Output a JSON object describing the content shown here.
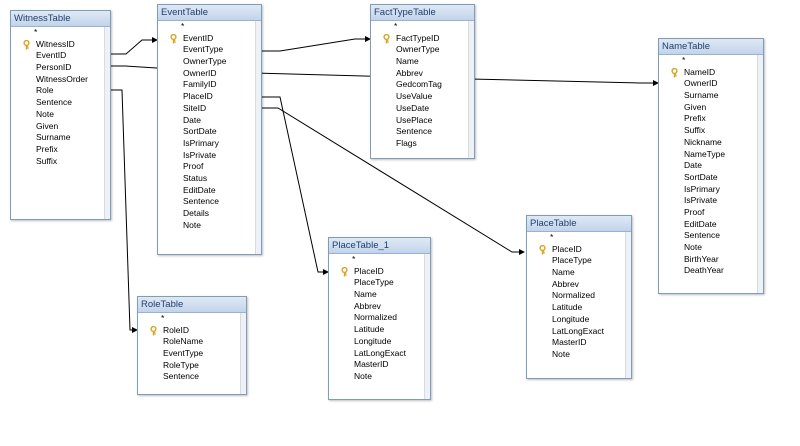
{
  "tables": {
    "witness": {
      "title": "WitnessTable",
      "fields": [
        {
          "name": "*",
          "key": false
        },
        {
          "name": "WitnessID",
          "key": true
        },
        {
          "name": "EventID",
          "key": false
        },
        {
          "name": "PersonID",
          "key": false
        },
        {
          "name": "WitnessOrder",
          "key": false
        },
        {
          "name": "Role",
          "key": false
        },
        {
          "name": "Sentence",
          "key": false
        },
        {
          "name": "Note",
          "key": false
        },
        {
          "name": "Given",
          "key": false
        },
        {
          "name": "Surname",
          "key": false
        },
        {
          "name": "Prefix",
          "key": false
        },
        {
          "name": "Suffix",
          "key": false
        }
      ]
    },
    "event": {
      "title": "EventTable",
      "fields": [
        {
          "name": "*",
          "key": false
        },
        {
          "name": "EventID",
          "key": true
        },
        {
          "name": "EventType",
          "key": false
        },
        {
          "name": "OwnerType",
          "key": false
        },
        {
          "name": "OwnerID",
          "key": false
        },
        {
          "name": "FamilyID",
          "key": false
        },
        {
          "name": "PlaceID",
          "key": false
        },
        {
          "name": "SiteID",
          "key": false
        },
        {
          "name": "Date",
          "key": false
        },
        {
          "name": "SortDate",
          "key": false
        },
        {
          "name": "IsPrimary",
          "key": false
        },
        {
          "name": "IsPrivate",
          "key": false
        },
        {
          "name": "Proof",
          "key": false
        },
        {
          "name": "Status",
          "key": false
        },
        {
          "name": "EditDate",
          "key": false
        },
        {
          "name": "Sentence",
          "key": false
        },
        {
          "name": "Details",
          "key": false
        },
        {
          "name": "Note",
          "key": false
        }
      ]
    },
    "facttype": {
      "title": "FactTypeTable",
      "fields": [
        {
          "name": "*",
          "key": false
        },
        {
          "name": "FactTypeID",
          "key": true
        },
        {
          "name": "OwnerType",
          "key": false
        },
        {
          "name": "Name",
          "key": false
        },
        {
          "name": "Abbrev",
          "key": false
        },
        {
          "name": "GedcomTag",
          "key": false
        },
        {
          "name": "UseValue",
          "key": false
        },
        {
          "name": "UseDate",
          "key": false
        },
        {
          "name": "UsePlace",
          "key": false
        },
        {
          "name": "Sentence",
          "key": false
        },
        {
          "name": "Flags",
          "key": false
        }
      ]
    },
    "name": {
      "title": "NameTable",
      "fields": [
        {
          "name": "*",
          "key": false
        },
        {
          "name": "NameID",
          "key": true
        },
        {
          "name": "OwnerID",
          "key": false
        },
        {
          "name": "Surname",
          "key": false
        },
        {
          "name": "Given",
          "key": false
        },
        {
          "name": "Prefix",
          "key": false
        },
        {
          "name": "Suffix",
          "key": false
        },
        {
          "name": "Nickname",
          "key": false
        },
        {
          "name": "NameType",
          "key": false
        },
        {
          "name": "Date",
          "key": false
        },
        {
          "name": "SortDate",
          "key": false
        },
        {
          "name": "IsPrimary",
          "key": false
        },
        {
          "name": "IsPrivate",
          "key": false
        },
        {
          "name": "Proof",
          "key": false
        },
        {
          "name": "EditDate",
          "key": false
        },
        {
          "name": "Sentence",
          "key": false
        },
        {
          "name": "Note",
          "key": false
        },
        {
          "name": "BirthYear",
          "key": false
        },
        {
          "name": "DeathYear",
          "key": false
        }
      ]
    },
    "role": {
      "title": "RoleTable",
      "fields": [
        {
          "name": "*",
          "key": false
        },
        {
          "name": "RoleID",
          "key": true
        },
        {
          "name": "RoleName",
          "key": false
        },
        {
          "name": "EventType",
          "key": false
        },
        {
          "name": "RoleType",
          "key": false
        },
        {
          "name": "Sentence",
          "key": false
        }
      ]
    },
    "place1": {
      "title": "PlaceTable_1",
      "fields": [
        {
          "name": "*",
          "key": false
        },
        {
          "name": "PlaceID",
          "key": true
        },
        {
          "name": "PlaceType",
          "key": false
        },
        {
          "name": "Name",
          "key": false
        },
        {
          "name": "Abbrev",
          "key": false
        },
        {
          "name": "Normalized",
          "key": false
        },
        {
          "name": "Latitude",
          "key": false
        },
        {
          "name": "Longitude",
          "key": false
        },
        {
          "name": "LatLongExact",
          "key": false
        },
        {
          "name": "MasterID",
          "key": false
        },
        {
          "name": "Note",
          "key": false
        }
      ]
    },
    "place": {
      "title": "PlaceTable",
      "fields": [
        {
          "name": "*",
          "key": false
        },
        {
          "name": "PlaceID",
          "key": true
        },
        {
          "name": "PlaceType",
          "key": false
        },
        {
          "name": "Name",
          "key": false
        },
        {
          "name": "Abbrev",
          "key": false
        },
        {
          "name": "Normalized",
          "key": false
        },
        {
          "name": "Latitude",
          "key": false
        },
        {
          "name": "Longitude",
          "key": false
        },
        {
          "name": "LatLongExact",
          "key": false
        },
        {
          "name": "MasterID",
          "key": false
        },
        {
          "name": "Note",
          "key": false
        }
      ]
    }
  },
  "colors": {
    "border": "#7f9db9",
    "title_text": "#1f3f70",
    "relationship_line": "#000000",
    "key_icon": "#d9a520"
  }
}
